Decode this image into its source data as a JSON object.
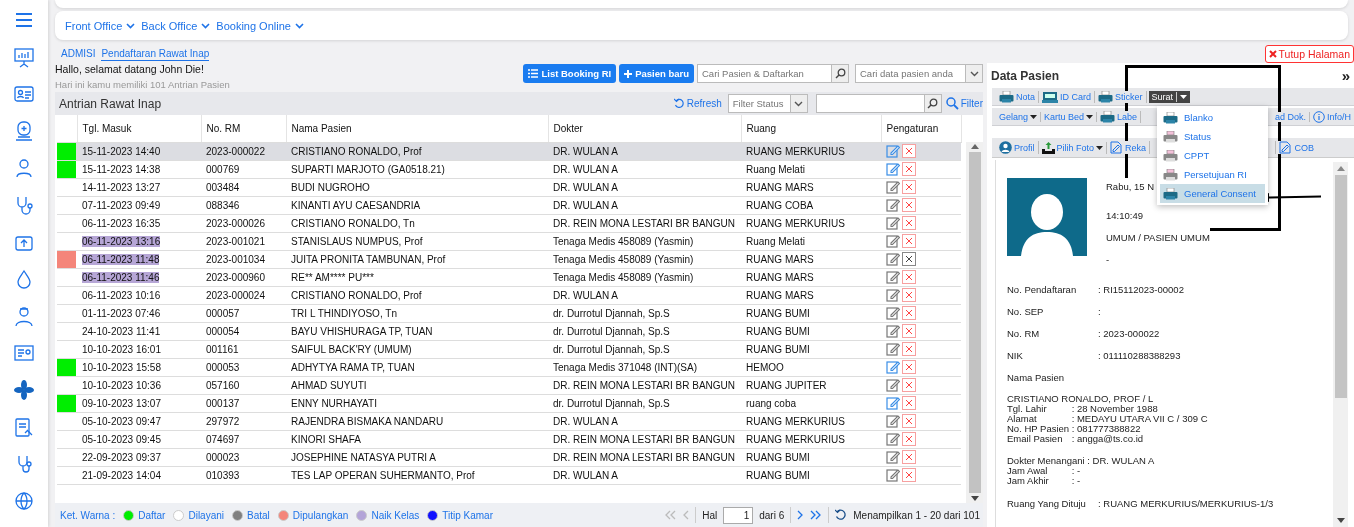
{
  "nav": {
    "menus": [
      "Front Office",
      "Back Office",
      "Booking Online"
    ]
  },
  "breadcrumb": [
    {
      "label": "ADMISI",
      "selected": false
    },
    {
      "label": "Pendaftaran Rawat Inap",
      "selected": true
    }
  ],
  "close_button": "Tutup Halaman",
  "greeting": "Hallo, selamat datang John Die!",
  "queue_info": "Hari ini kamu memiliki  101 Antrian Pasien",
  "queue": {
    "buttons": [
      "List Booking RI",
      "Pasien baru"
    ],
    "patient_search": {
      "placeholder": "Cari Pasien & Daftarkan"
    },
    "data_search": {
      "placeholder": "Cari data pasien anda"
    },
    "title": "Antrian Rawat Inap",
    "refresh": "Refresh",
    "filter_status": {
      "placeholder": "Filter Status"
    },
    "filter": "Filter",
    "table": {
      "columns": [
        "Tgl. Masuk",
        "No. RM",
        "Nama Pasien",
        "Dokter",
        "Ruang",
        "Pengaturan"
      ],
      "rows": [
        {
          "date": "15-11-2023 14:40",
          "rm": "2023-000022",
          "name": "CRISTIANO RONALDO, Prof",
          "doctor": "DR. WULAN A",
          "room": "RUANG MERKURIUS",
          "selected": true,
          "color": "#00ee00",
          "date_marked": false,
          "edit_highlighted": true,
          "delete_enabled": true
        },
        {
          "date": "15-11-2023 14:38",
          "rm": "000769",
          "name": "SUPARTI MARJOTO (GA0518.21)",
          "doctor": "DR. WULAN A",
          "room": "Ruang Melati",
          "selected": false,
          "color": "#00ee00",
          "date_marked": false,
          "edit_highlighted": true,
          "delete_enabled": true
        },
        {
          "date": "14-11-2023 13:27",
          "rm": "003484",
          "name": "BUDI NUGROHO",
          "doctor": "DR. WULAN A",
          "room": "RUANG MARS",
          "selected": false,
          "date_marked": false,
          "edit_highlighted": false,
          "delete_enabled": true
        },
        {
          "date": "07-11-2023 09:49",
          "rm": "088346",
          "name": "KINANTI AYU CAESANDRIA",
          "doctor": "DR. WULAN A",
          "room": "RUANG COBA",
          "selected": false,
          "date_marked": false,
          "edit_highlighted": false,
          "delete_enabled": true
        },
        {
          "date": "06-11-2023 16:35",
          "rm": "2023-000026",
          "name": "CRISTIANO RONALDO, Tn",
          "doctor": "DR. REIN MONA LESTARI BR BANGUN",
          "room": "RUANG MERKURIUS",
          "selected": false,
          "date_marked": false,
          "edit_highlighted": false,
          "delete_enabled": true
        },
        {
          "date": "06-11-2023 13:16",
          "rm": "2023-001021",
          "name": "STANISLAUS NUMPUS, Prof",
          "doctor": "Tenaga Medis 458089 (Yasmin)",
          "room": "Ruang Melati",
          "selected": false,
          "date_marked": true,
          "edit_highlighted": false,
          "delete_enabled": true
        },
        {
          "date": "06-11-2023 11:48",
          "rm": "2023-001034",
          "name": "JUITA PRONITA TAMBUNAN, Prof",
          "doctor": "Tenaga Medis 458089 (Yasmin)",
          "room": "RUANG MARS",
          "selected": false,
          "color": "#f4857a",
          "date_marked": true,
          "edit_highlighted": false,
          "delete_enabled": false
        },
        {
          "date": "06-11-2023 11:46",
          "rm": "2023-000960",
          "name": "RE** AM**** PU***",
          "doctor": "Tenaga Medis 458089 (Yasmin)",
          "room": "RUANG MARS",
          "selected": false,
          "date_marked": true,
          "edit_highlighted": false,
          "delete_enabled": true
        },
        {
          "date": "06-11-2023 10:16",
          "rm": "2023-000024",
          "name": "CRISTIANO RONALDO, Prof",
          "doctor": "DR. WULAN A",
          "room": "RUANG MARS",
          "selected": false,
          "date_marked": false,
          "edit_highlighted": false,
          "delete_enabled": true
        },
        {
          "date": "01-11-2023 07:46",
          "rm": "000057",
          "name": "TRI L THINDIYOSO, Tn",
          "doctor": "dr. Durrotul Djannah, Sp.S",
          "room": "RUANG BUMI",
          "selected": false,
          "date_marked": false,
          "edit_highlighted": false,
          "delete_enabled": true
        },
        {
          "date": "24-10-2023 11:41",
          "rm": "000054",
          "name": "BAYU VHISHURAGA TP, TUAN",
          "doctor": "dr. Durrotul Djannah, Sp.S",
          "room": "RUANG BUMI",
          "selected": false,
          "date_marked": false,
          "edit_highlighted": false,
          "delete_enabled": true
        },
        {
          "date": "10-10-2023 16:01",
          "rm": "001161",
          "name": "SAIFUL BACK'RY (UMUM)",
          "doctor": "dr. Durrotul Djannah, Sp.S",
          "room": "RUANG BUMI",
          "selected": false,
          "date_marked": false,
          "edit_highlighted": false,
          "delete_enabled": true
        },
        {
          "date": "10-10-2023 15:58",
          "rm": "000053",
          "name": "ADHYTYA RAMA TP, TUAN",
          "doctor": "Tenaga Medis 371048 (INT)(SA)",
          "room": "HEMOO",
          "selected": false,
          "color": "#00ee00",
          "date_marked": false,
          "edit_highlighted": true,
          "delete_enabled": true
        },
        {
          "date": "10-10-2023 10:36",
          "rm": "057160",
          "name": "AHMAD SUYUTI",
          "doctor": "DR. REIN MONA LESTARI BR BANGUN",
          "room": "RUANG JUPITER",
          "selected": false,
          "date_marked": false,
          "edit_highlighted": false,
          "delete_enabled": true
        },
        {
          "date": "09-10-2023 13:07",
          "rm": "000137",
          "name": "ENNY NURHAYATI",
          "doctor": "dr. Durrotul Djannah, Sp.S",
          "room": "ruang coba",
          "selected": false,
          "color": "#00ee00",
          "date_marked": false,
          "edit_highlighted": true,
          "delete_enabled": true
        },
        {
          "date": "05-10-2023 09:47",
          "rm": "297972",
          "name": "RAJENDRA BISMAKA NANDARU",
          "doctor": "DR. WULAN A",
          "room": "RUANG MERKURIUS",
          "selected": false,
          "date_marked": false,
          "edit_highlighted": false,
          "delete_enabled": true
        },
        {
          "date": "05-10-2023 09:45",
          "rm": "074697",
          "name": "KINORI SHAFA",
          "doctor": "DR. REIN MONA LESTARI BR BANGUN",
          "room": "RUANG MERKURIUS",
          "selected": false,
          "date_marked": false,
          "edit_highlighted": false,
          "delete_enabled": true
        },
        {
          "date": "22-09-2023 09:37",
          "rm": "000023",
          "name": "JOSEPHINE NATASYA PUTRI A",
          "doctor": "DR. REIN MONA LESTARI BR BANGUN",
          "room": "RUANG BUMI",
          "selected": false,
          "date_marked": false,
          "edit_highlighted": false,
          "delete_enabled": true
        },
        {
          "date": "21-09-2023 14:04",
          "rm": "010393",
          "name": "TES LAP OPERAN SUHERMANTO, Prof",
          "doctor": "DR. WULAN A",
          "room": "RUANG BUMI",
          "selected": false,
          "date_marked": false,
          "edit_highlighted": false,
          "delete_enabled": true
        }
      ]
    },
    "legend": {
      "label": "Ket. Warna :",
      "items": [
        {
          "label": "Daftar",
          "color": "#00ee00"
        },
        {
          "label": "Dilayani",
          "color": "#ffffff"
        },
        {
          "label": "Batal",
          "color": "#808080"
        },
        {
          "label": "Dipulangkan",
          "color": "#f4857a"
        },
        {
          "label": "Naik Kelas",
          "color": "#b3a4d8"
        },
        {
          "label": "Titip Kamar",
          "color": "#1010ff"
        }
      ]
    },
    "pagination": {
      "page_label": "Hal",
      "page": "1",
      "total": "dari 6",
      "summary": "Menampilkan 1 - 20 dari 101"
    }
  },
  "patient": {
    "title": "Data Pasien",
    "collapse": "»",
    "toolbar_1": [
      {
        "label": "Nota",
        "kind": "button"
      },
      {
        "label": "ID Card",
        "kind": "button"
      },
      {
        "label": "Sticker",
        "kind": "button"
      },
      {
        "label": "Surat",
        "kind": "split"
      }
    ],
    "toolbar_2": [
      {
        "label": "Gelang",
        "kind": "dropdown"
      },
      {
        "label": "Kartu Bed",
        "kind": "dropdown"
      },
      {
        "label": "Labe",
        "kind": "button"
      },
      {
        "label": "ad Dok.",
        "kind": "text"
      },
      {
        "label": "Info/H",
        "kind": "button"
      }
    ],
    "toolbar_3": [
      {
        "label": "Profil",
        "kind": "button"
      },
      {
        "label": "Pilih Foto",
        "kind": "dropdown"
      },
      {
        "label": "Reka",
        "kind": "button"
      },
      {
        "label": "COB",
        "kind": "button"
      }
    ],
    "surat_menu": [
      {
        "label": "Blanko",
        "selected": false
      },
      {
        "label": "Status",
        "selected": false
      },
      {
        "label": "CPPT",
        "selected": false
      },
      {
        "label": "Persetujuan RI",
        "selected": false
      },
      {
        "label": "General Consent",
        "selected": true
      }
    ],
    "date": "Rabu, 15 N",
    "time": "14:10:49",
    "guarantor": "UMUM / PASIEN UMUM",
    "note": "-",
    "fields": [
      {
        "label": "No. Pendaftaran",
        "value": ": RI15112023-00002"
      },
      {
        "label": "No. SEP",
        "value": ":"
      },
      {
        "label": "No. RM",
        "value": ": 2023-000022"
      },
      {
        "label": "NIK",
        "value": ": 011110288388293"
      },
      {
        "label": "Nama Pasien"
      }
    ],
    "name": "CRISTIANO RONALDO, PROF / L",
    "details": [
      {
        "label": "Tgl. Lahir",
        "value": ": 28 November 1988"
      },
      {
        "label": "Alamat",
        "value": ": MEDAYU UTARA VII C / 309 C"
      },
      {
        "label": "No. HP Pasien",
        "value": ": 081777388822"
      },
      {
        "label": "Email Pasien",
        "value": ": angga@ts.co.id"
      }
    ],
    "doctor": [
      {
        "label": "Dokter Menangani",
        "value": ": DR. WULAN A"
      },
      {
        "label": "Jam Awal",
        "value": ": -"
      },
      {
        "label": "Jam Akhir",
        "value": ": -"
      }
    ],
    "room": {
      "label": "Ruang Yang Dituju",
      "value": ": RUANG MERKURIUS/MERKURIUS-1/3"
    }
  },
  "annotation": {
    "box": true,
    "arrow": true
  }
}
